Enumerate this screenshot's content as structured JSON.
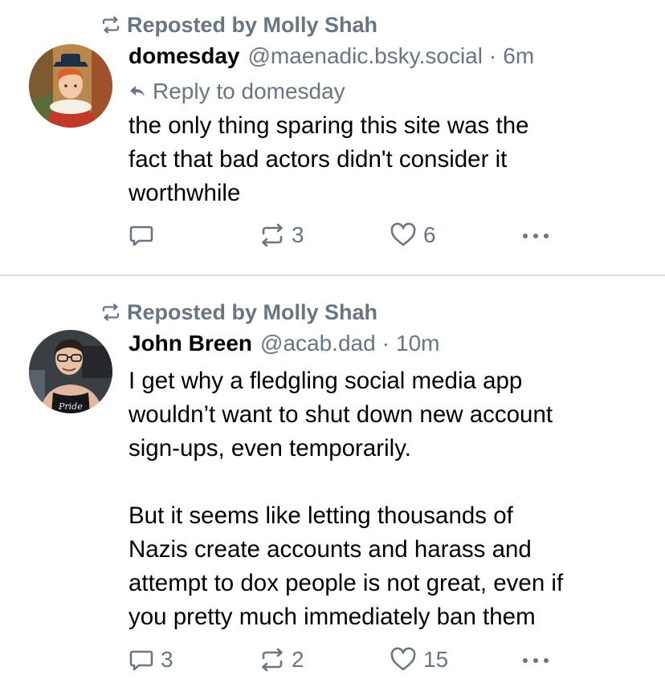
{
  "colors": {
    "text": "#000000",
    "muted": "#687684",
    "divider": "#d8dde2",
    "background": "#ffffff"
  },
  "posts": [
    {
      "repost_label": "Reposted by Molly Shah",
      "author_name": "domesday",
      "author_handle": "@maenadic.bsky.social",
      "separator": "·",
      "time": "6m",
      "reply_label": "Reply to domesday",
      "text": "the only thing sparing this site was the\nfact that bad actors didn't consider it\nworthwhile",
      "reply_count": "",
      "repost_count": "3",
      "like_count": "6",
      "icons": {
        "repost": "repost-icon",
        "reply_arrow": "reply-arrow-icon",
        "comment": "comment-icon",
        "like": "heart-icon",
        "more": "more-icon"
      }
    },
    {
      "repost_label": "Reposted by Molly Shah",
      "author_name": "John Breen",
      "author_handle": "@acab.dad",
      "separator": "·",
      "time": "10m",
      "text": "I get why a fledgling social media app\nwouldn’t want to shut down new account\nsign-ups, even temporarily.\n\nBut it seems like letting thousands of\nNazis create accounts and harass and\nattempt to dox people is not great, even if\nyou pretty much immediately ban them",
      "reply_count": "3",
      "repost_count": "2",
      "like_count": "15",
      "avatar_shirt_text": "Pride",
      "icons": {
        "repost": "repost-icon",
        "comment": "comment-icon",
        "like": "heart-icon",
        "more": "more-icon"
      }
    }
  ]
}
